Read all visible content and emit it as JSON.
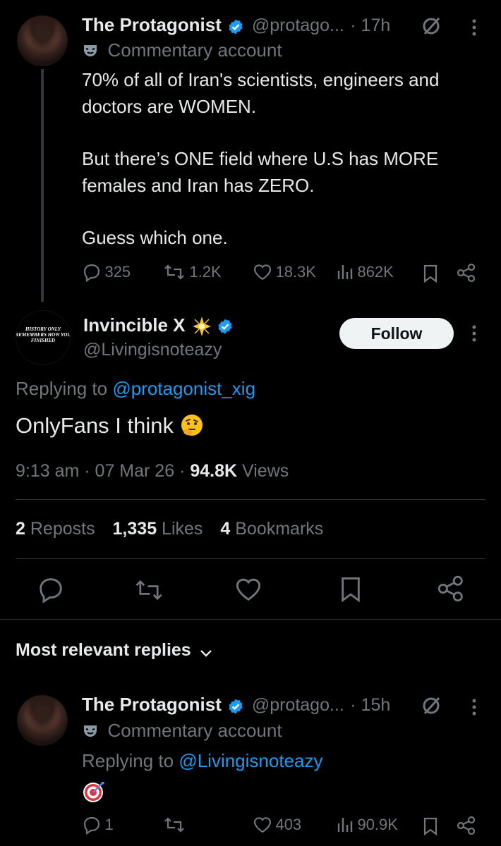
{
  "tweet1": {
    "name": "The Protagonist",
    "handle": "@protago...",
    "dot_time": "· 17h",
    "label": "Commentary account",
    "text_line1": "70% of all of Iran's scientists, engineers and",
    "text_line2": "doctors are WOMEN.",
    "text_line3": "But there’s ONE field where U.S has MORE",
    "text_line4": "females and Iran has ZERO.",
    "text_line5": "Guess which one.",
    "replies": "325",
    "reposts": "1.2K",
    "likes": "18.3K",
    "views": "862K"
  },
  "main_tweet": {
    "avatar_text": "HISTORY ONLY REMEMBERS HOW YOU FINISHED",
    "name": "Invincible X",
    "handle": "@Livingisnoteazy",
    "follow_label": "Follow",
    "replying_prefix": "Replying to",
    "replying_handle": "@protagonist_xig",
    "text": "OnlyFans I think",
    "time": "9:13 am · 07 Mar 26 ·",
    "views_count": "94.8K",
    "views_label": "Views",
    "reposts_count": "2",
    "reposts_label": "Reposts",
    "likes_count": "1,335",
    "likes_label": "Likes",
    "bookmarks_count": "4",
    "bookmarks_label": "Bookmarks"
  },
  "replies_section": {
    "title": "Most relevant replies"
  },
  "reply1": {
    "name": "The Protagonist",
    "handle": "@protago...",
    "dot_time": "· 15h",
    "label": "Commentary account",
    "replying_prefix": "Replying to",
    "replying_handle": "@Livingisnoteazy",
    "replies": "1",
    "likes": "403",
    "views": "90.9K"
  },
  "colors": {
    "background": "#000000",
    "text": "#e7e9ea",
    "secondary": "#71767b",
    "accent": "#1d9bf0"
  }
}
